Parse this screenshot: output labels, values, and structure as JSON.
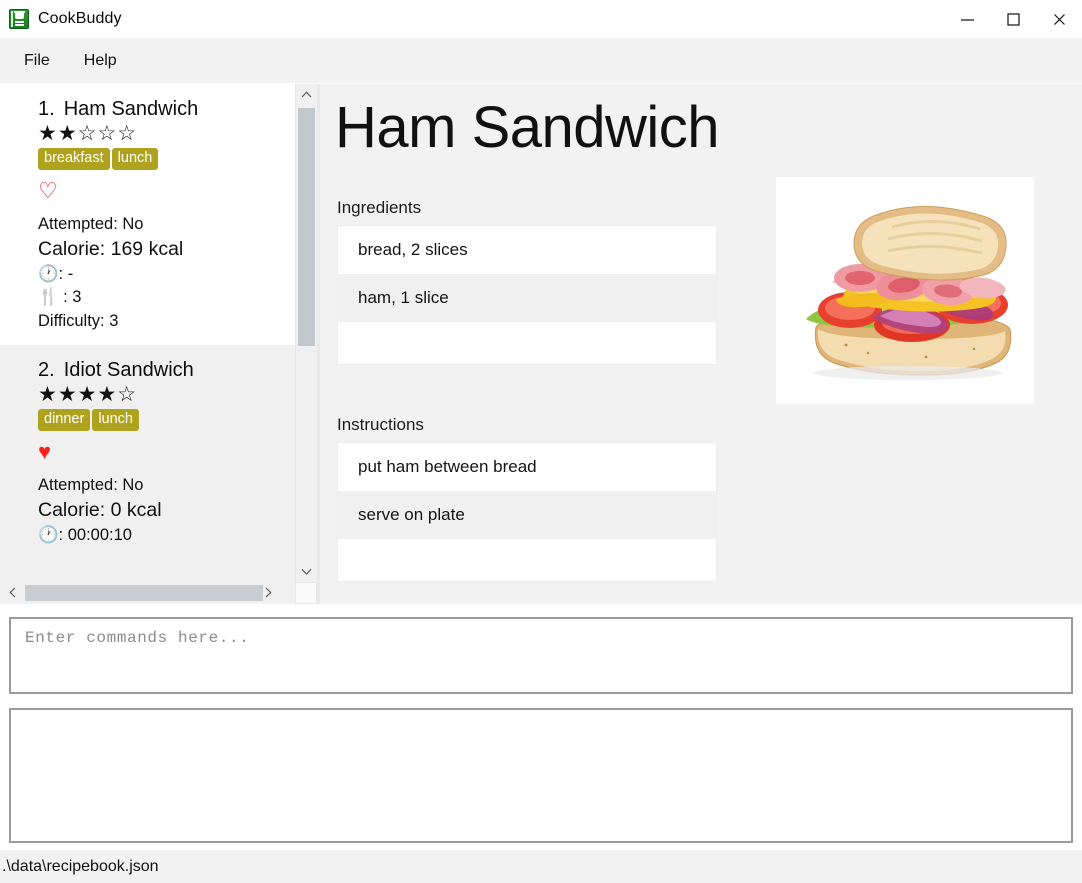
{
  "window": {
    "title": "CookBuddy",
    "app_icon": "green-recipe-book-icon",
    "minimize_label": "Minimize",
    "maximize_label": "Maximize",
    "close_label": "Close"
  },
  "menubar": {
    "items": [
      {
        "label": "File"
      },
      {
        "label": "Help"
      }
    ]
  },
  "recipe_list": {
    "items": [
      {
        "number": "1.",
        "name": "Ham Sandwich",
        "stars": "★★☆☆☆",
        "rating": 2,
        "tags": [
          "breakfast",
          "lunch"
        ],
        "favorite": false,
        "heart": "♡",
        "attempted": "Attempted: No",
        "calorie": "Calorie: 169 kcal",
        "time_icon": "🕐",
        "time": "🕐: -",
        "servings_icon": "🍴",
        "servings": "🍴 : 3",
        "difficulty": "Difficulty: 3",
        "selected": true
      },
      {
        "number": "2.",
        "name": "Idiot Sandwich",
        "stars": "★★★★☆",
        "rating": 4,
        "tags": [
          "dinner",
          "lunch"
        ],
        "favorite": true,
        "heart": "♥",
        "attempted": "Attempted: No",
        "calorie": "Calorie: 0 kcal",
        "time_icon": "🕐",
        "time": "🕐: 00:00:10",
        "servings_icon": "🍴",
        "servings": "",
        "difficulty": "",
        "selected": false
      }
    ],
    "tag_color": "#afa21e",
    "favorite_color": "#ff2020"
  },
  "detail": {
    "title": "Ham Sandwich",
    "ingredients_label": "Ingredients",
    "ingredients": [
      "bread, 2 slices",
      "ham, 1 slice",
      "",
      ""
    ],
    "instructions_label": "Instructions",
    "instructions": [
      "put ham between bread",
      "serve on plate",
      "",
      ""
    ],
    "photo_alt": "ham-sandwich-photo"
  },
  "command": {
    "input_placeholder": "Enter commands here...",
    "input_value": "",
    "output_value": ""
  },
  "statusbar": {
    "path": ".\\data\\recipebook.json"
  }
}
